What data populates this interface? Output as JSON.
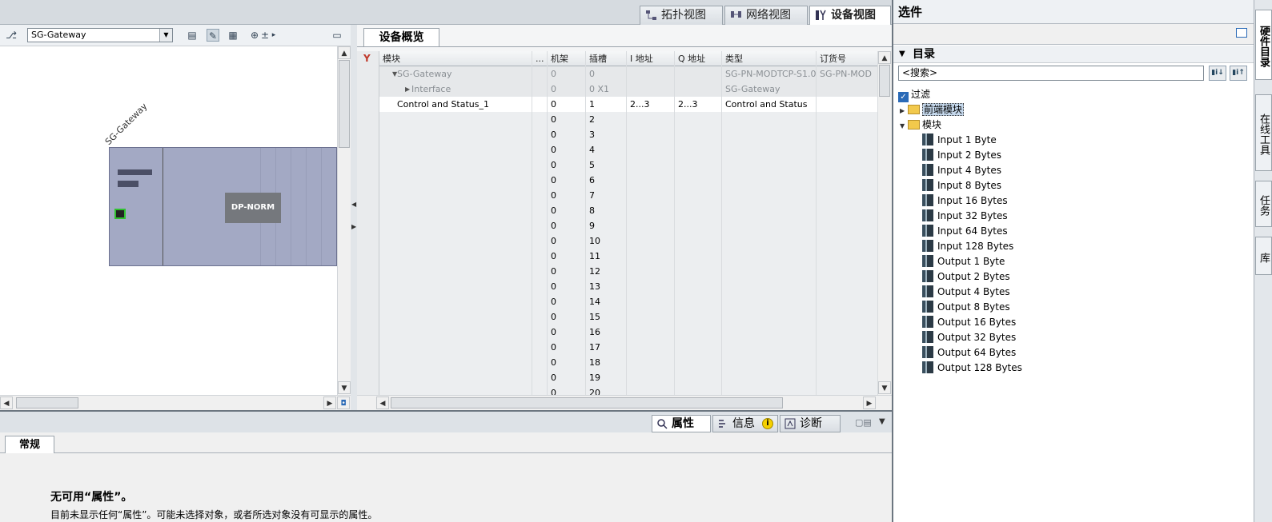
{
  "view_tabs": [
    {
      "label": "拓扑视图",
      "icon": "topology-view-icon"
    },
    {
      "label": "网络视图",
      "icon": "network-view-icon"
    },
    {
      "label": "设备视图",
      "icon": "device-view-icon"
    }
  ],
  "device_view": {
    "device_select": "SG-Gateway",
    "device_label": "SG-Gateway",
    "module_label": "DP-NORM"
  },
  "overview": {
    "tab": "设备概览",
    "columns": [
      "模块",
      "...",
      "机架",
      "插槽",
      "I 地址",
      "Q 地址",
      "类型",
      "订货号"
    ],
    "rows": [
      {
        "module": "SG-Gateway",
        "rack": "0",
        "slot": "0",
        "i_addr": "",
        "q_addr": "",
        "type": "SG-PN-MODTCP-S1.0",
        "order": "SG-PN-MOD"
      },
      {
        "module": "Interface",
        "rack": "0",
        "slot": "0 X1",
        "i_addr": "",
        "q_addr": "",
        "type": "SG-Gateway",
        "order": ""
      },
      {
        "module": "Control and Status_1",
        "rack": "0",
        "slot": "1",
        "i_addr": "2...3",
        "q_addr": "2...3",
        "type": "Control and Status",
        "order": ""
      },
      {
        "module": "",
        "rack": "0",
        "slot": "2"
      },
      {
        "module": "",
        "rack": "0",
        "slot": "3"
      },
      {
        "module": "",
        "rack": "0",
        "slot": "4"
      },
      {
        "module": "",
        "rack": "0",
        "slot": "5"
      },
      {
        "module": "",
        "rack": "0",
        "slot": "6"
      },
      {
        "module": "",
        "rack": "0",
        "slot": "7"
      },
      {
        "module": "",
        "rack": "0",
        "slot": "8"
      },
      {
        "module": "",
        "rack": "0",
        "slot": "9"
      },
      {
        "module": "",
        "rack": "0",
        "slot": "10"
      },
      {
        "module": "",
        "rack": "0",
        "slot": "11"
      },
      {
        "module": "",
        "rack": "0",
        "slot": "12"
      },
      {
        "module": "",
        "rack": "0",
        "slot": "13"
      },
      {
        "module": "",
        "rack": "0",
        "slot": "14"
      },
      {
        "module": "",
        "rack": "0",
        "slot": "15"
      },
      {
        "module": "",
        "rack": "0",
        "slot": "16"
      },
      {
        "module": "",
        "rack": "0",
        "slot": "17"
      },
      {
        "module": "",
        "rack": "0",
        "slot": "18"
      },
      {
        "module": "",
        "rack": "0",
        "slot": "19"
      },
      {
        "module": "",
        "rack": "0",
        "slot": "20"
      }
    ]
  },
  "properties": {
    "tabs": [
      {
        "label": "属性",
        "icon": "properties-icon"
      },
      {
        "label": "信息",
        "icon": "info-icon"
      },
      {
        "label": "诊断",
        "icon": "diagnostics-icon"
      }
    ],
    "general_tab": "常规",
    "title": "无可用“属性”。",
    "description": "目前未显示任何“属性”。可能未选择对象，或者所选对象没有可显示的属性。"
  },
  "catalog": {
    "title": "选件",
    "section": "目录",
    "search_placeholder": "<搜索>",
    "filter_label": "过滤",
    "tree": [
      {
        "label": "前端模块",
        "level": 0,
        "expanded": false,
        "kind": "folder",
        "selected": true
      },
      {
        "label": "模块",
        "level": 0,
        "expanded": true,
        "kind": "folder"
      },
      {
        "label": "Input 1 Byte",
        "level": 1,
        "kind": "module"
      },
      {
        "label": "Input 2 Bytes",
        "level": 1,
        "kind": "module"
      },
      {
        "label": "Input 4 Bytes",
        "level": 1,
        "kind": "module"
      },
      {
        "label": "Input 8 Bytes",
        "level": 1,
        "kind": "module"
      },
      {
        "label": "Input 16 Bytes",
        "level": 1,
        "kind": "module"
      },
      {
        "label": "Input 32 Bytes",
        "level": 1,
        "kind": "module"
      },
      {
        "label": "Input 64 Bytes",
        "level": 1,
        "kind": "module"
      },
      {
        "label": "Input 128 Bytes",
        "level": 1,
        "kind": "module"
      },
      {
        "label": "Output 1 Byte",
        "level": 1,
        "kind": "module"
      },
      {
        "label": "Output 2 Bytes",
        "level": 1,
        "kind": "module"
      },
      {
        "label": "Output 4 Bytes",
        "level": 1,
        "kind": "module"
      },
      {
        "label": "Output 8 Bytes",
        "level": 1,
        "kind": "module"
      },
      {
        "label": "Output 16 Bytes",
        "level": 1,
        "kind": "module"
      },
      {
        "label": "Output 32 Bytes",
        "level": 1,
        "kind": "module"
      },
      {
        "label": "Output 64 Bytes",
        "level": 1,
        "kind": "module"
      },
      {
        "label": "Output 128 Bytes",
        "level": 1,
        "kind": "module"
      }
    ]
  },
  "side_tabs": [
    "硬件目录",
    "在线工具",
    "任务",
    "库"
  ],
  "colors": {
    "accent": "#2a6ab7",
    "rack": "#a3a9c4",
    "port_ok": "#2fc12f"
  }
}
